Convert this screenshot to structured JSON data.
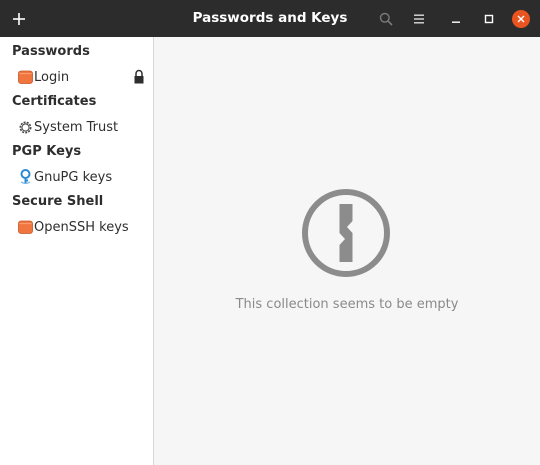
{
  "window": {
    "title": "Passwords and Keys"
  },
  "headerbar": {
    "add_icon": "plus-icon",
    "search_icon": "search-icon",
    "menu_icon": "hamburger-menu-icon",
    "minimize_icon": "minimize-icon",
    "maximize_icon": "maximize-icon",
    "close_icon": "close-icon",
    "close_color": "#e95420"
  },
  "sidebar": {
    "sections": [
      {
        "title": "Passwords",
        "items": [
          {
            "label": "Login",
            "icon": "folder-orange-icon",
            "locked": true
          }
        ]
      },
      {
        "title": "Certificates",
        "items": [
          {
            "label": "System Trust",
            "icon": "gear-certificate-icon",
            "locked": false
          }
        ]
      },
      {
        "title": "PGP Keys",
        "items": [
          {
            "label": "GnuPG keys",
            "icon": "gnupg-icon",
            "locked": false
          }
        ]
      },
      {
        "title": "Secure Shell",
        "items": [
          {
            "label": "OpenSSH keys",
            "icon": "folder-orange-icon",
            "locked": false
          }
        ]
      }
    ]
  },
  "main": {
    "empty_icon": "keyhole-icon",
    "empty_message": "This collection seems to be empty"
  },
  "colors": {
    "headerbar": "#2c2c2c",
    "accent": "#e95420",
    "folder": "#f0753f",
    "empty_icon": "#8c8c8c"
  }
}
